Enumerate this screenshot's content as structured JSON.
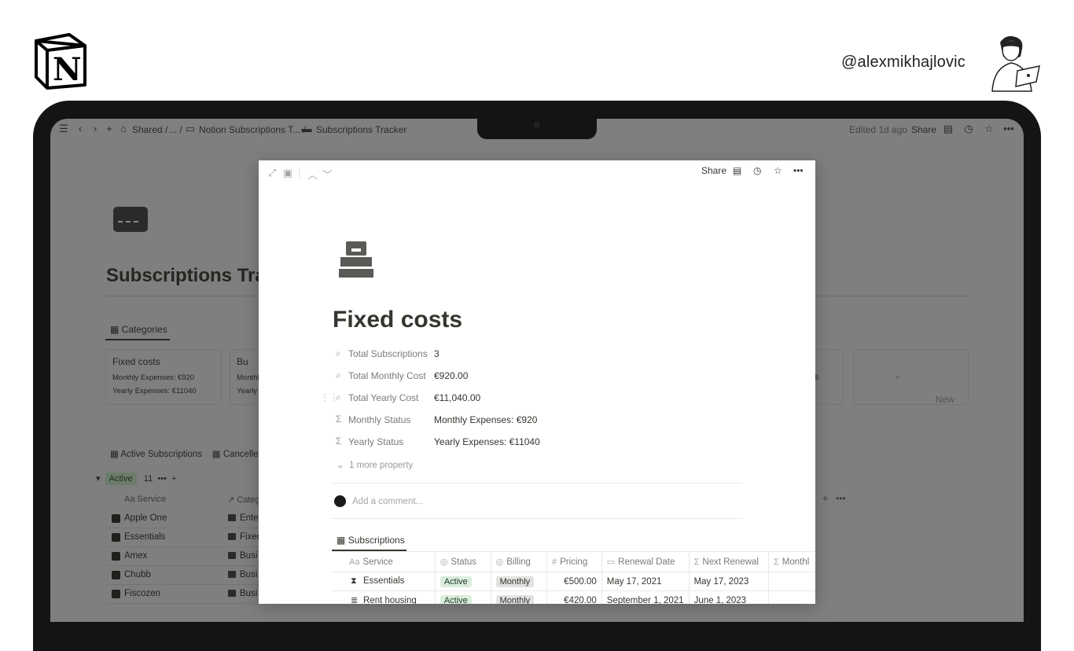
{
  "branding": {
    "handle": "@alexmikhajlovic",
    "logo_icon": "notion-logo-icon",
    "avatar_icon": "illustrated-avatar-icon"
  },
  "app": {
    "breadcrumb": [
      "Shared",
      "...",
      "Notion Subscriptions T...",
      "Subscriptions Tracker"
    ],
    "edited": "Edited 1d ago",
    "share": "Share",
    "page_title": "Subscriptions Tra",
    "tab": "Categories",
    "cards": [
      {
        "title": "Fixed costs",
        "line1": "Monthly Expenses: €920",
        "line2": "Yearly Expenses: €11040"
      },
      {
        "title": "Bu",
        "line1": "Monthl",
        "line2": "Yearly"
      }
    ],
    "card_fragment": "6",
    "new_label": "New",
    "views": [
      "Active Subscriptions",
      "Cancelle"
    ],
    "group": {
      "label": "Active",
      "count": "11"
    },
    "table_headers": [
      "Service",
      "Categ"
    ],
    "rows": [
      {
        "service": "Apple One",
        "category": "Ente"
      },
      {
        "service": "Essentials",
        "category": "Fixed"
      },
      {
        "service": "Amex",
        "category": "Busi"
      },
      {
        "service": "Chubb",
        "category": "Busi"
      },
      {
        "service": "Fiscozen",
        "category": "Busi"
      }
    ]
  },
  "modal": {
    "share": "Share",
    "title": "Fixed costs",
    "properties": [
      {
        "icon": "search-icon",
        "label": "Total Subscriptions",
        "value": "3"
      },
      {
        "icon": "search-icon",
        "label": "Total Monthly Cost",
        "value": "€920.00"
      },
      {
        "icon": "search-icon",
        "label": "Total Yearly Cost",
        "value": "€11,040.00"
      },
      {
        "icon": "sigma-icon",
        "label": "Monthly Status",
        "value": "Monthly Expenses: €920"
      },
      {
        "icon": "sigma-icon",
        "label": "Yearly Status",
        "value": "Yearly Expenses: €11040"
      }
    ],
    "more_property": "1 more property",
    "comment_placeholder": "Add a comment...",
    "db_tab": "Subscriptions",
    "columns": [
      {
        "icon": "Aa",
        "label": "Service"
      },
      {
        "icon": "◎",
        "label": "Status"
      },
      {
        "icon": "◎",
        "label": "Billing"
      },
      {
        "icon": "#",
        "label": "Pricing"
      },
      {
        "icon": "▭",
        "label": "Renewal Date"
      },
      {
        "icon": "Σ",
        "label": "Next Renewal"
      },
      {
        "icon": "Σ",
        "label": "Monthl"
      }
    ],
    "rows": [
      {
        "service": "Essentials",
        "status": "Active",
        "billing": "Monthly",
        "pricing": "€500.00",
        "renewal": "May 17, 2021",
        "next": "May 17, 2023"
      },
      {
        "service": "Rent housing",
        "status": "Active",
        "billing": "Monthly",
        "pricing": "€420.00",
        "renewal": "September 1, 2021",
        "next": "June 1, 2023"
      }
    ]
  }
}
